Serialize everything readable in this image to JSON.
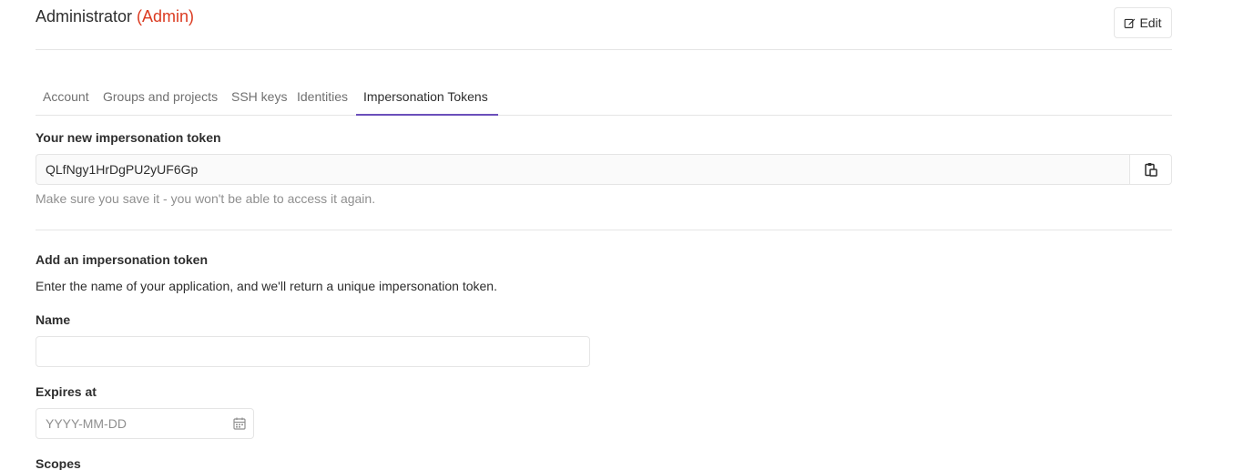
{
  "header": {
    "name": "Administrator",
    "role": "(Admin)",
    "edit_label": "Edit"
  },
  "tabs": [
    {
      "label": "Account",
      "active": false
    },
    {
      "label": "Groups and projects",
      "active": false
    },
    {
      "label": "SSH keys",
      "active": false
    },
    {
      "label": "Identities",
      "active": false
    },
    {
      "label": "Impersonation Tokens",
      "active": true
    }
  ],
  "new_token": {
    "heading": "Your new impersonation token",
    "value": "QLfNgy1HrDgPU2yUF6Gp",
    "help": "Make sure you save it - you won't be able to access it again."
  },
  "add_token": {
    "heading": "Add an impersonation token",
    "description": "Enter the name of your application, and we'll return a unique impersonation token.",
    "name_label": "Name",
    "name_value": "",
    "expires_label": "Expires at",
    "expires_placeholder": "YYYY-MM-DD",
    "scopes_label": "Scopes"
  },
  "colors": {
    "accent": "#6b4fbb",
    "admin_red": "#db3b21",
    "border": "#e5e5e5"
  },
  "icons": {
    "edit": "edit-icon",
    "copy": "clipboard-icon",
    "calendar": "calendar-icon"
  }
}
